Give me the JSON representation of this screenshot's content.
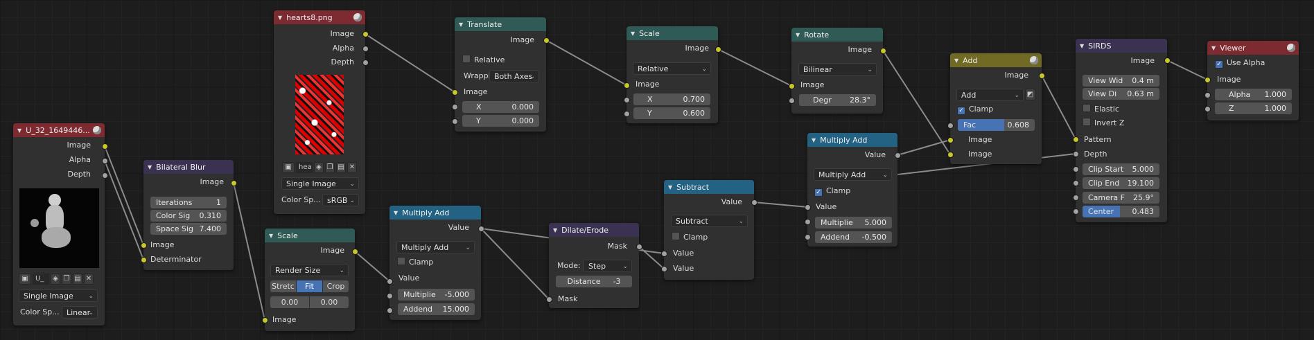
{
  "colors": {
    "image_socket": "#c7c729",
    "value_socket": "#a1a1a1",
    "accent": "#4772b3"
  },
  "nodes": {
    "image1": {
      "title": "U_32_1649446...",
      "outputs": [
        "Image",
        "Alpha",
        "Depth"
      ],
      "image_name": "U_",
      "source": "Single Image",
      "color_space_label": "Color Sp...",
      "color_space": "Linear"
    },
    "bilateral": {
      "title": "Bilateral Blur",
      "output": "Image",
      "fields": [
        {
          "label": "Iterations",
          "value": "1"
        },
        {
          "label": "Color Sig",
          "value": "0.310"
        },
        {
          "label": "Space Sig",
          "value": "7.400"
        }
      ],
      "inputs": [
        "Image",
        "Determinator"
      ]
    },
    "hearts": {
      "title": "hearts8.png",
      "outputs": [
        "Image",
        "Alpha",
        "Depth"
      ],
      "image_name": "hea",
      "source": "Single Image",
      "color_space_label": "Color Sp...",
      "color_space": "sRGB"
    },
    "scale1": {
      "title": "Scale",
      "output": "Image",
      "mode": "Render Size",
      "fit_options": [
        "Stretc",
        "Fit",
        "Crop"
      ],
      "fit_active": "Fit",
      "offset_x": "0.00",
      "offset_y": "0.00",
      "input": "Image"
    },
    "translate": {
      "title": "Translate",
      "output": "Image",
      "relative_label": "Relative",
      "wrapping_label": "Wrappi",
      "wrapping": "Both Axes",
      "input": "Image",
      "x_label": "X",
      "x": "0.000",
      "y_label": "Y",
      "y": "0.000"
    },
    "muladd1": {
      "title": "Multiply Add",
      "output": "Value",
      "operation": "Multiply Add",
      "clamp_label": "Clamp",
      "input": "Value",
      "multiplier_label": "Multiplie",
      "multiplier": "-5.000",
      "addend_label": "Addend",
      "addend": "15.000"
    },
    "scale2": {
      "title": "Scale",
      "output": "Image",
      "mode": "Relative",
      "input": "Image",
      "x_label": "X",
      "x": "0.700",
      "y_label": "Y",
      "y": "0.600"
    },
    "dilate": {
      "title": "Dilate/Erode",
      "output": "Mask",
      "mode_label": "Mode:",
      "mode": "Step",
      "distance_label": "Distance",
      "distance": "-3",
      "input": "Mask"
    },
    "subtract": {
      "title": "Subtract",
      "output": "Value",
      "operation": "Subtract",
      "clamp_label": "Clamp",
      "inputs": [
        "Value",
        "Value"
      ]
    },
    "rotate": {
      "title": "Rotate",
      "output": "Image",
      "filter": "Bilinear",
      "input": "Image",
      "degree_label": "Degr",
      "degree": "28.3°"
    },
    "muladd2": {
      "title": "Multiply Add",
      "output": "Value",
      "operation": "Multiply Add",
      "clamp_label": "Clamp",
      "input": "Value",
      "multiplier_label": "Multiplie",
      "multiplier": "5.000",
      "addend_label": "Addend",
      "addend": "-0.500"
    },
    "add": {
      "title": "Add",
      "output": "Image",
      "blend": "Add",
      "clamp_label": "Clamp",
      "fac_label": "Fac",
      "fac": "0.608",
      "fac_fraction": 0.608,
      "inputs": [
        "Image",
        "Image"
      ]
    },
    "sirds": {
      "title": "SIRDS",
      "output": "Image",
      "fields": [
        {
          "label": "View Wid",
          "value": "0.4 m"
        },
        {
          "label": "View Di",
          "value": "0.63 m"
        }
      ],
      "elastic_label": "Elastic",
      "invert_label": "Invert Z",
      "inputs": [
        "Pattern",
        "Depth"
      ],
      "clip_fields": [
        {
          "label": "Clip Start",
          "value": "5.000"
        },
        {
          "label": "Clip End",
          "value": "19.100"
        },
        {
          "label": "Camera F",
          "value": "25.9°"
        }
      ],
      "center_label": "Center",
      "center": "0.483",
      "center_fraction": 0.483
    },
    "viewer": {
      "title": "Viewer",
      "use_alpha_label": "Use Alpha",
      "input": "Image",
      "alpha_label": "Alpha",
      "alpha": "1.000",
      "z_label": "Z",
      "z": "1.000"
    }
  }
}
